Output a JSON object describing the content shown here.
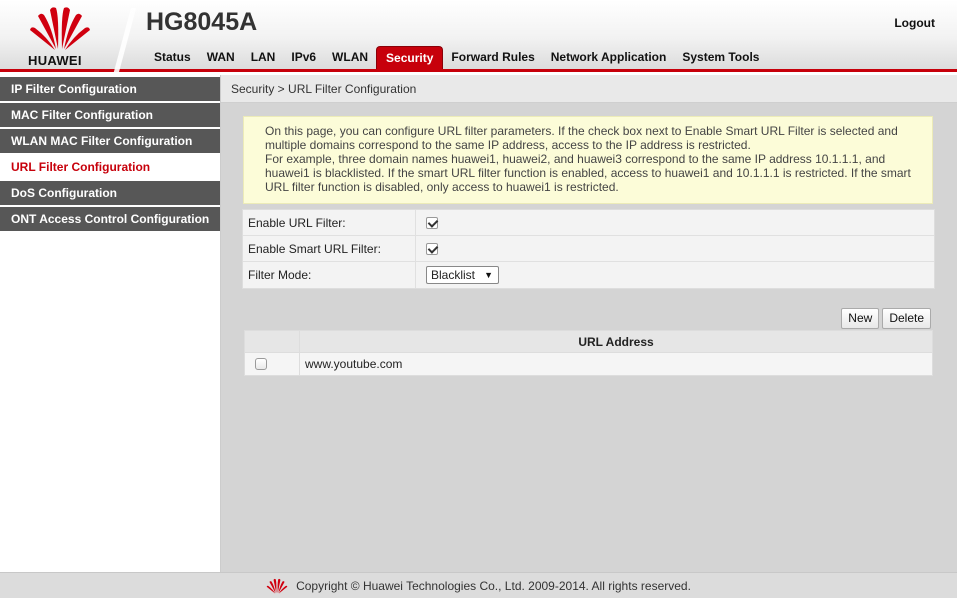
{
  "header": {
    "brand": "HUAWEI",
    "model": "HG8045A",
    "logout_label": "Logout",
    "accent_color": "#c7000b"
  },
  "nav": {
    "items": [
      {
        "label": "Status"
      },
      {
        "label": "WAN"
      },
      {
        "label": "LAN"
      },
      {
        "label": "IPv6"
      },
      {
        "label": "WLAN"
      },
      {
        "label": "Security"
      },
      {
        "label": "Forward Rules"
      },
      {
        "label": "Network Application"
      },
      {
        "label": "System Tools"
      }
    ],
    "active": "Security"
  },
  "sidebar": {
    "items": [
      {
        "label": "IP Filter Configuration"
      },
      {
        "label": "MAC Filter Configuration"
      },
      {
        "label": "WLAN MAC Filter Configuration"
      },
      {
        "label": "URL Filter Configuration"
      },
      {
        "label": "DoS Configuration"
      },
      {
        "label": "ONT Access Control Configuration"
      }
    ],
    "active": "URL Filter Configuration"
  },
  "breadcrumb": "Security > URL Filter Configuration",
  "info": {
    "line1": "On this page, you can configure URL filter parameters. If the check box next to Enable Smart URL Filter is selected and multiple domains correspond to the same IP address, access to the IP address is restricted.",
    "line2": "For example, three domain names huawei1, huawei2, and huawei3 correspond to the same IP address 10.1.1.1, and huawei1 is blacklisted. If the smart URL filter function is enabled, access to huawei1 and 10.1.1.1 is restricted. If the smart URL filter function is disabled, only access to huawei1 is restricted."
  },
  "form": {
    "enable_url_filter_label": "Enable URL Filter:",
    "enable_url_filter_checked": true,
    "enable_smart_url_filter_label": "Enable Smart URL Filter:",
    "enable_smart_url_filter_checked": true,
    "filter_mode_label": "Filter Mode:",
    "filter_mode_value": "Blacklist"
  },
  "buttons": {
    "new_label": "New",
    "delete_label": "Delete"
  },
  "table": {
    "header_url": "URL Address",
    "rows": [
      {
        "url": "www.youtube.com",
        "checked": false
      }
    ]
  },
  "footer": {
    "copyright": "Copyright © Huawei Technologies Co., Ltd. 2009-2014. All rights reserved."
  },
  "icons": {
    "logo": "huawei-logo-icon",
    "footer_logo": "huawei-logo-icon",
    "dropdown": "triangle-down-icon"
  }
}
